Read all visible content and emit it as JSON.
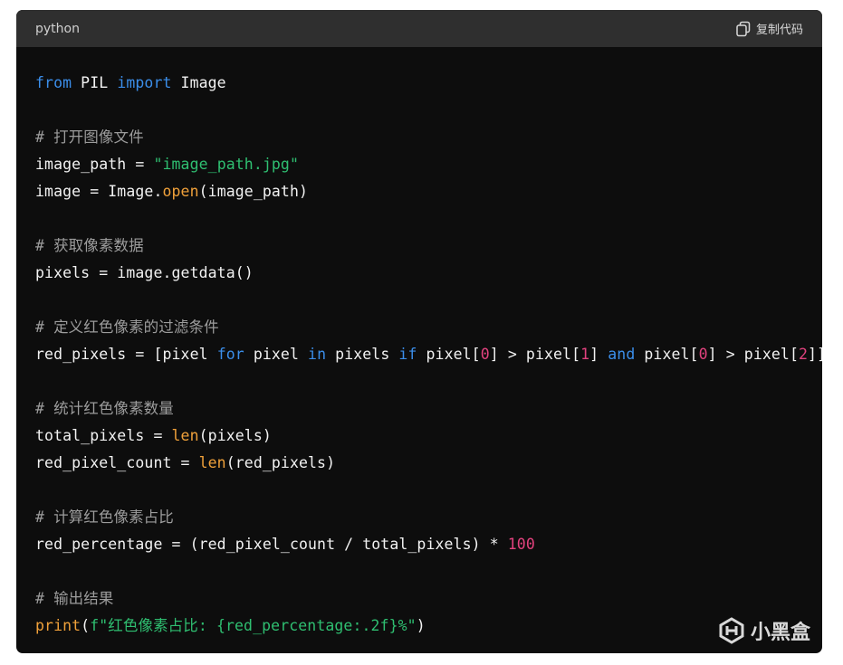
{
  "header": {
    "language": "python",
    "copy_label": "复制代码",
    "copy_icon": "copy-icon"
  },
  "colors": {
    "keyword": "#3b8eea",
    "string": "#2fbf71",
    "builtin": "#f0a13a",
    "number": "#e2427e",
    "comment": "#9c9c9c",
    "text": "#f2f2f2"
  },
  "code": {
    "l1": {
      "kw1": "from",
      "t1": " PIL ",
      "kw2": "import",
      "t2": " Image"
    },
    "l3": "# 打开图像文件",
    "l4": {
      "t1": "image_path = ",
      "s1": "\"image_path.jpg\""
    },
    "l5": {
      "t1": "image = Image.",
      "f1": "open",
      "t2": "(image_path)"
    },
    "l7": "# 获取像素数据",
    "l8": "pixels = image.getdata()",
    "l10": "# 定义红色像素的过滤条件",
    "l11": {
      "t1": "red_pixels = [pixel ",
      "kw1": "for",
      "t2": " pixel ",
      "kw2": "in",
      "t3": " pixels ",
      "kw3": "if",
      "t4": " pixel[",
      "n1": "0",
      "t5": "] > pixel[",
      "n2": "1",
      "t6": "] ",
      "kw4": "and",
      "t7": " pixel[",
      "n3": "0",
      "t8": "] > pixel[",
      "n4": "2",
      "t9": "]]"
    },
    "l13": "# 统计红色像素数量",
    "l14": {
      "t1": "total_pixels = ",
      "f1": "len",
      "t2": "(pixels)"
    },
    "l15": {
      "t1": "red_pixel_count = ",
      "f1": "len",
      "t2": "(red_pixels)"
    },
    "l17": "# 计算红色像素占比",
    "l18": {
      "t1": "red_percentage = (red_pixel_count / total_pixels) * ",
      "n1": "100"
    },
    "l20": "# 输出结果",
    "l21": {
      "f1": "print",
      "t1": "(",
      "s1": "f\"红色像素占比: {red_percentage:.2f}%\"",
      "t2": ")"
    }
  },
  "watermark": {
    "text": "小黑盒",
    "icon": "heybox-logo-icon"
  }
}
